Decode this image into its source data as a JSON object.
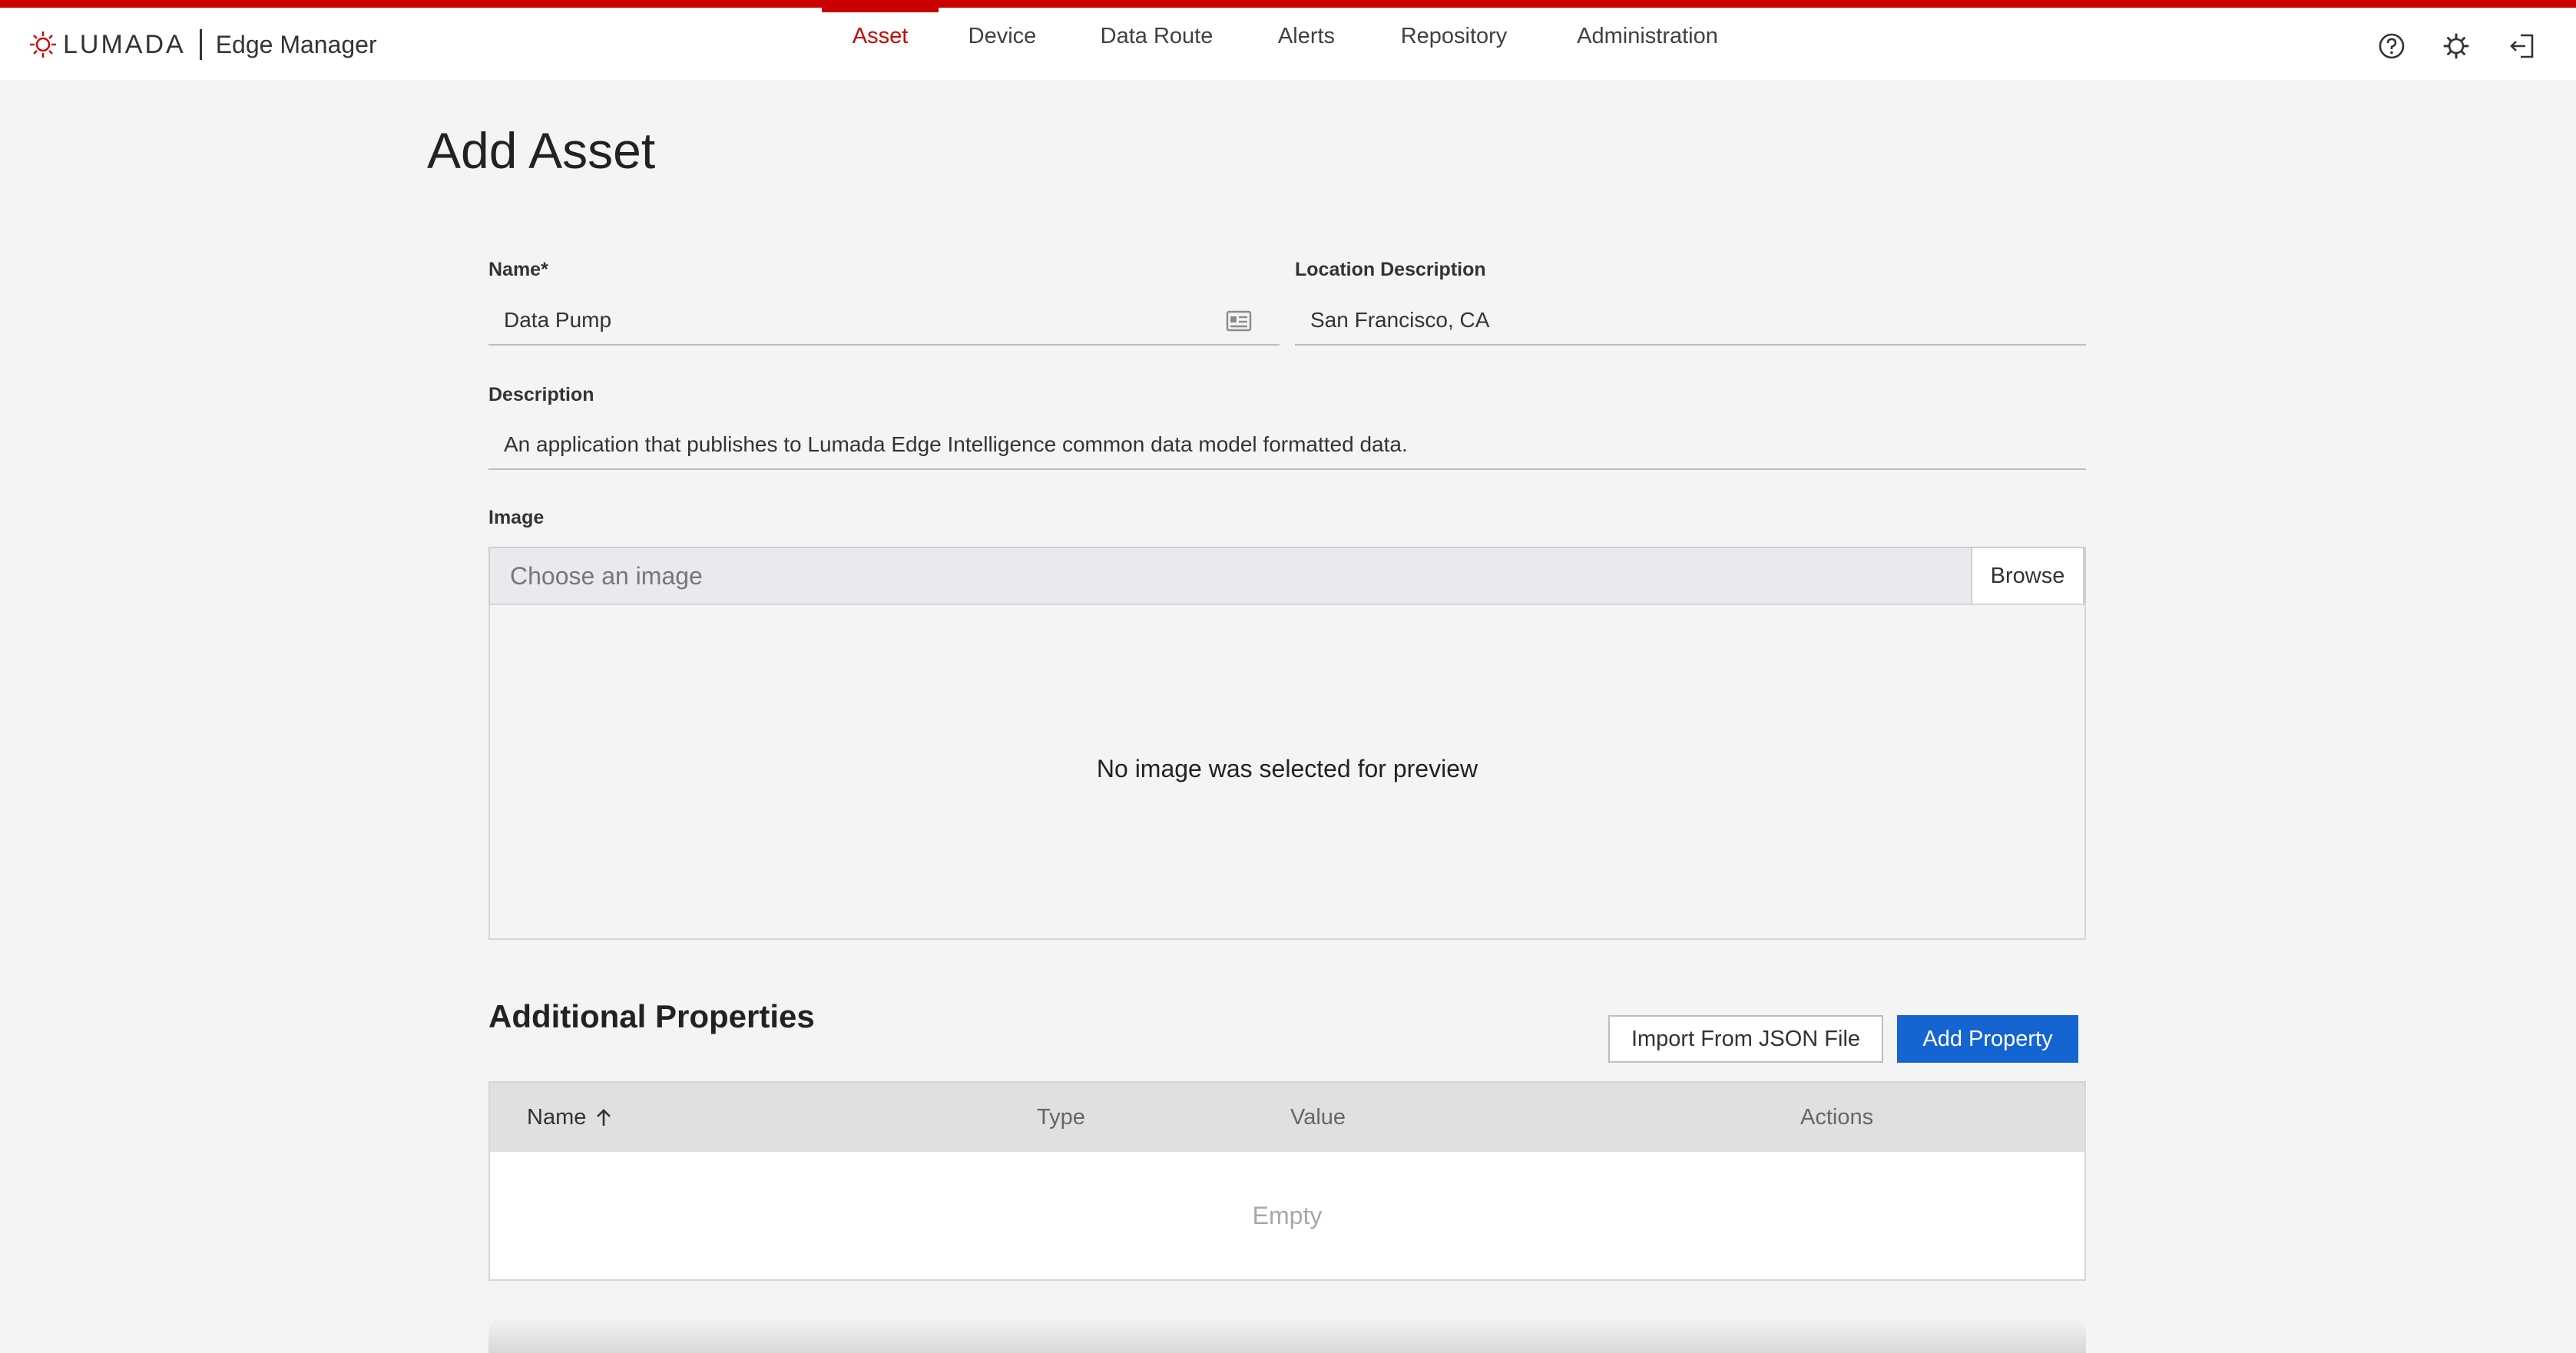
{
  "header": {
    "brand_name": "LUMADA",
    "app_name": "Edge Manager",
    "nav": [
      {
        "label": "Asset",
        "active": true
      },
      {
        "label": "Device",
        "active": false
      },
      {
        "label": "Data Route",
        "active": false
      },
      {
        "label": "Alerts",
        "active": false
      },
      {
        "label": "Repository",
        "active": false
      },
      {
        "label": "Administration",
        "active": false
      }
    ],
    "icons": [
      "help-icon",
      "settings-icon",
      "logout-icon"
    ]
  },
  "page": {
    "title": "Add Asset"
  },
  "form": {
    "name": {
      "label": "Name*",
      "value": "Data Pump",
      "icon": "contact-card-icon"
    },
    "location": {
      "label": "Location Description",
      "value": "San Francisco, CA"
    },
    "description": {
      "label": "Description",
      "value": "An application that publishes to Lumada Edge Intelligence common data model formatted data."
    },
    "image": {
      "label": "Image",
      "placeholder": "Choose an image",
      "browse_label": "Browse",
      "preview_text": "No image was selected for preview"
    }
  },
  "additional_properties": {
    "title": "Additional Properties",
    "import_label": "Import From JSON File",
    "add_label": "Add Property",
    "columns": [
      "Name",
      "Type",
      "Value",
      "Actions"
    ],
    "sort_column": "Name",
    "sort_direction": "ascending",
    "empty_text": "Empty"
  },
  "colors": {
    "accent_red": "#cc0000",
    "primary_blue": "#1464d2",
    "background": "#f4f4f5"
  }
}
